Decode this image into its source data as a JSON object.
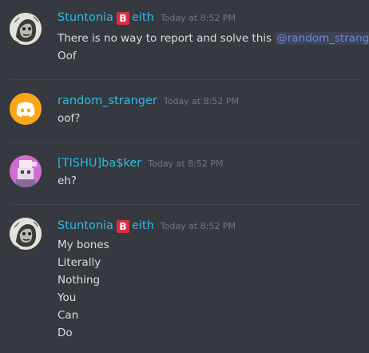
{
  "messages": [
    {
      "author": "Stuntonia",
      "author_suffix": "eith",
      "badge": "B",
      "timestamp": "Today at 8:52 PM",
      "lines": [
        "There is no way to report and solve this",
        "Oof"
      ],
      "mention": "@random_stranger"
    },
    {
      "author": "random_stranger",
      "timestamp": "Today at 8:52 PM",
      "lines": [
        "oof?"
      ]
    },
    {
      "author": "[TISHU]ba$ker",
      "timestamp": "Today at 8:52 PM",
      "lines": [
        "eh?"
      ]
    },
    {
      "author": "Stuntonia",
      "author_suffix": "eith",
      "badge": "B",
      "timestamp": "Today at 8:52 PM",
      "lines": [
        "My bones",
        "Literally",
        "Nothing",
        "You",
        "Can",
        "Do"
      ]
    }
  ],
  "colors": {
    "background": "#36393f",
    "username": "#2fbbe4",
    "mention": "#7289da",
    "badge": "#dd2e44",
    "discord_blurple": "#7289da",
    "default_avatar": "#faa61a"
  },
  "icons": {
    "default_avatar": "discord-logo-icon",
    "badge": "b-button-emoji-icon"
  }
}
